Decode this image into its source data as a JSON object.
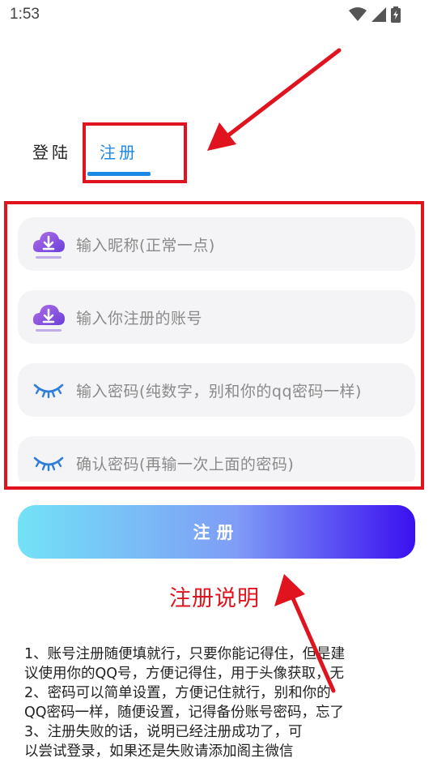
{
  "status_bar": {
    "time": "1:53"
  },
  "tabs": [
    {
      "label": "登陆",
      "active": false
    },
    {
      "label": "注册",
      "active": true
    }
  ],
  "fields": [
    {
      "placeholder": "输入昵称(正常一点)",
      "icon": "cloud-download-icon"
    },
    {
      "placeholder": "输入你注册的账号",
      "icon": "cloud-download-icon"
    },
    {
      "placeholder": "输入密码(纯数字，别和你的qq密码一样)",
      "icon": "closed-eye-icon"
    },
    {
      "placeholder": "确认密码(再输一次上面的密码)",
      "icon": "closed-eye-icon"
    }
  ],
  "register_button": {
    "label": "注册"
  },
  "annotation": {
    "title": "注册说明"
  },
  "instructions": [
    "1、账号注册随便填就行，只要你能记得住，但是建",
    "议使用你的QQ号，方便记得住，用于头像获取，无",
    "2、密码可以简单设置，方便记住就行，别和你的",
    "QQ密码一样，随便设置，记得备份账号密码，忘了",
    "3、注册失败的话，说明已经注册成功了，可",
    "以尝试登录，如果还是失败请添加阁主微信"
  ],
  "colors": {
    "accent": "#1e88e5",
    "annotation_red": "#e0141e",
    "button_start": "#72e2f6",
    "button_end": "#3b10f0"
  }
}
